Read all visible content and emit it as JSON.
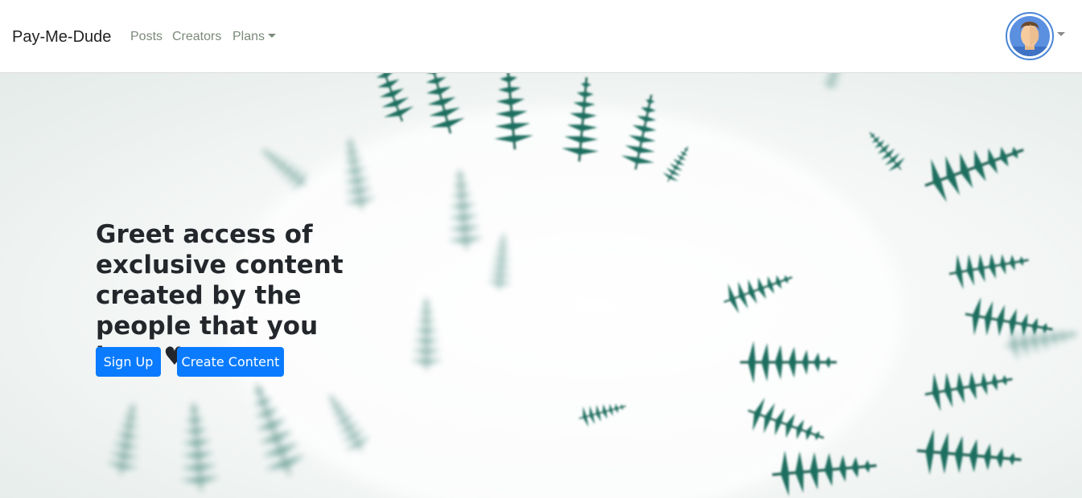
{
  "navbar": {
    "brand": "Pay-Me-Dude",
    "links": [
      {
        "label": "Posts"
      },
      {
        "label": "Creators"
      },
      {
        "label": "Plans"
      }
    ]
  },
  "user": {
    "avatar_icon": "user-avatar-icon"
  },
  "hero": {
    "headline": "Greet access of exclusive content created by the people that you love ♥",
    "signup_label": "Sign Up",
    "create_label": "Create Content"
  },
  "colors": {
    "primary": "#0a7bff",
    "fern": "#1f6e5f",
    "nav_link": "#7b8a7b",
    "avatar_ring": "#4a86d8"
  }
}
